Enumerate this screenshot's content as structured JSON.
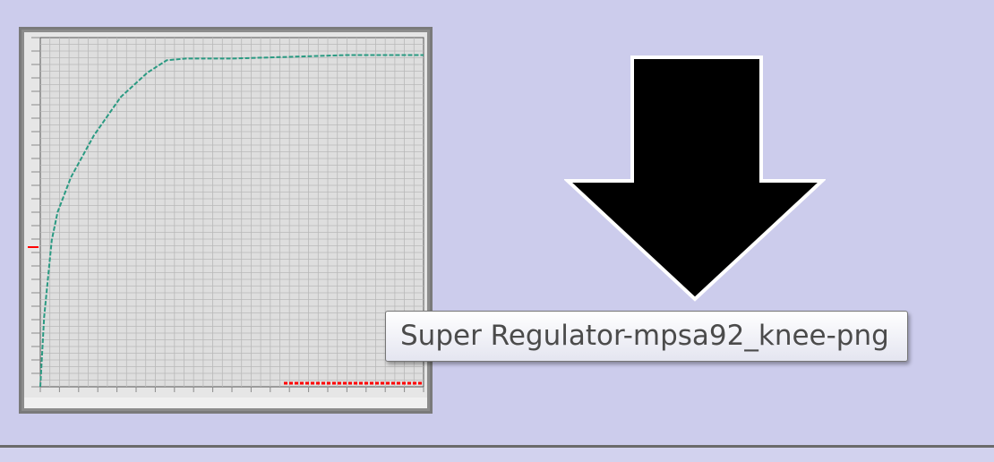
{
  "tooltip": {
    "text": "Super Regulator-mpsa92_knee-png"
  },
  "icons": {
    "arrow": "down-arrow-icon"
  },
  "colors": {
    "background": "#ccccec",
    "curve": "#2a9a82",
    "grid": "#b9b9b9",
    "marker": "#ff0000"
  },
  "chart_data": {
    "type": "line",
    "series": [
      {
        "values": [
          {
            "x": 0.0,
            "y": 0.0
          },
          {
            "x": 0.01,
            "y": 0.2
          },
          {
            "x": 0.03,
            "y": 0.42
          },
          {
            "x": 0.045,
            "y": 0.5
          },
          {
            "x": 0.08,
            "y": 0.6
          },
          {
            "x": 0.14,
            "y": 0.72
          },
          {
            "x": 0.21,
            "y": 0.83
          },
          {
            "x": 0.28,
            "y": 0.9
          },
          {
            "x": 0.33,
            "y": 0.935
          },
          {
            "x": 0.38,
            "y": 0.94
          },
          {
            "x": 0.5,
            "y": 0.94
          },
          {
            "x": 0.65,
            "y": 0.945
          },
          {
            "x": 0.8,
            "y": 0.95
          },
          {
            "x": 1.0,
            "y": 0.95
          }
        ]
      }
    ],
    "xlim": [
      0,
      1
    ],
    "ylim": [
      0,
      1
    ],
    "grid": true
  }
}
